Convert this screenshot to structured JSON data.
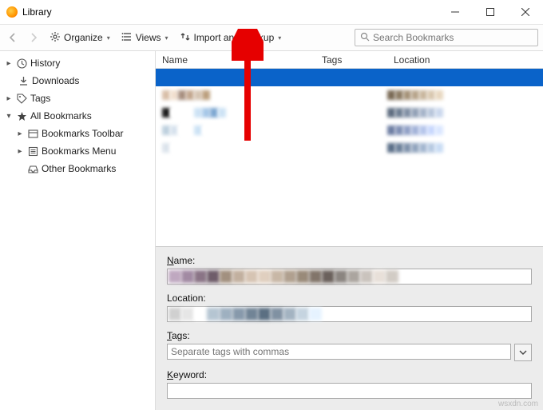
{
  "window": {
    "title": "Library"
  },
  "toolbar": {
    "organize": "Organize",
    "views": "Views",
    "import_backup": "Import and Backup",
    "search_placeholder": "Search Bookmarks"
  },
  "sidebar": {
    "history": "History",
    "downloads": "Downloads",
    "tags": "Tags",
    "all_bookmarks": "All Bookmarks",
    "toolbar": "Bookmarks Toolbar",
    "menu": "Bookmarks Menu",
    "other": "Other Bookmarks"
  },
  "columns": {
    "name": "Name",
    "tags": "Tags",
    "location": "Location"
  },
  "details": {
    "name_label": "Name:",
    "location_label": "Location:",
    "tags_label": "Tags:",
    "keyword_label": "Keyword:",
    "tags_placeholder": "Separate tags with commas"
  },
  "watermark": "wsxdn.com",
  "mosaic": {
    "rows": [
      [
        "#d9bfa8",
        "#f1e0cf",
        "#a89080",
        "#c3a78f",
        "#d6c5b3",
        "#bca07e"
      ],
      [
        "#1c1c1c",
        "#ffffff",
        "#ffffff",
        "#ffffff",
        "#cde3f5",
        "#a7c8e8",
        "#7ea8d2",
        "#cde3f5"
      ],
      [
        "#bfd1df",
        "#d8e3ee",
        "#ffffff",
        "#ffffff",
        "#cde3f5",
        "#ffffff"
      ],
      [
        "#dce4ec",
        "#ffffff",
        "#ffffff",
        "#ffffff",
        "#ffffff",
        "#ffffff"
      ]
    ],
    "loc_rows": [
      [
        "#7a6a55",
        "#8d7c65",
        "#a69379",
        "#b8a58c",
        "#c9b79e",
        "#d9c8b0",
        "#e8d8c1"
      ],
      [
        "#5e6d80",
        "#6f7f93",
        "#8190a5",
        "#93a2b7",
        "#a6b4c9",
        "#b8c6db",
        "#cbd8ed"
      ],
      [
        "#6e7ea3",
        "#8090b5",
        "#92a2c7",
        "#a4b4d9",
        "#b6c6eb",
        "#c8d8fd",
        "#dbe7ff"
      ],
      [
        "#5b6f88",
        "#6d819a",
        "#8093ac",
        "#92a5be",
        "#a4b7d0",
        "#b7cae2",
        "#c9dcf4"
      ]
    ],
    "name_field": [
      "#bfa8c0",
      "#a28aa3",
      "#8a7486",
      "#6f5d6a",
      "#a2907f",
      "#c2b09f",
      "#d6c4b3",
      "#e0cfbf",
      "#c8b7a6",
      "#b0a08f",
      "#998a79",
      "#82756a",
      "#6b615c",
      "#8b8580",
      "#aba59f",
      "#cac3bd",
      "#e8e0d9",
      "#d2ccc5"
    ],
    "location_field": [
      "#d0d0d0",
      "#e6e6e6",
      "#ffffff",
      "#b5c5d2",
      "#9eb0c0",
      "#8799ab",
      "#718496",
      "#5b6f82",
      "#8091a2",
      "#a3b3c1",
      "#c5d4e0",
      "#e6f3ff"
    ]
  }
}
